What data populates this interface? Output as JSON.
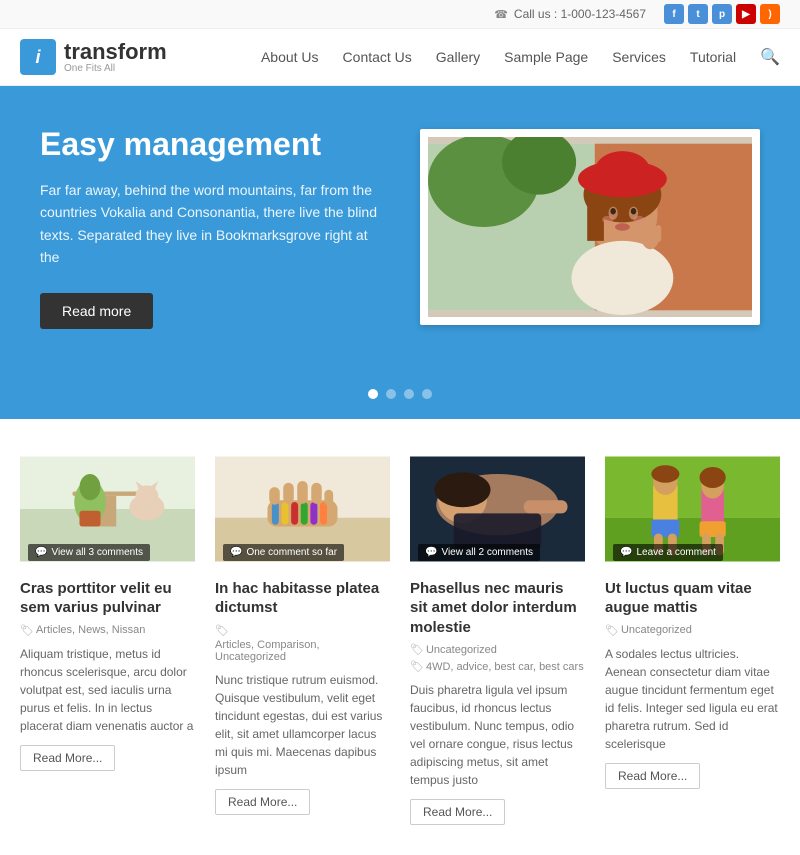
{
  "topbar": {
    "phone": "Call us : 1-000-123-4567",
    "socials": [
      {
        "name": "facebook",
        "label": "f"
      },
      {
        "name": "twitter",
        "label": "t"
      },
      {
        "name": "pinterest",
        "label": "p"
      },
      {
        "name": "youtube",
        "label": "y"
      },
      {
        "name": "rss",
        "label": "r"
      }
    ]
  },
  "header": {
    "logo_letter": "i",
    "logo_title": "transform",
    "logo_subtitle": "One Fits All",
    "nav_items": [
      {
        "label": "About Us"
      },
      {
        "label": "Contact Us"
      },
      {
        "label": "Gallery"
      },
      {
        "label": "Sample Page"
      },
      {
        "label": "Services"
      },
      {
        "label": "Tutorial"
      }
    ]
  },
  "hero": {
    "title": "Easy management",
    "text": "Far far away, behind the word mountains, far from the countries Vokalia and Consonantia, there live the blind texts. Separated they live in Bookmarksgrove right at the",
    "btn_label": "Read more",
    "dots": [
      true,
      false,
      false,
      false
    ]
  },
  "cards": [
    {
      "id": 1,
      "comment_badge": "View all 3 comments",
      "title": "Cras porttitor velit eu sem varius pulvinar",
      "tags": "Articles, News, Nissan",
      "body": "Aliquam tristique, metus id rhoncus scelerisque, arcu dolor volutpat est, sed iaculis urna purus et felis. In in lectus placerat diam venenatis auctor a",
      "readmore": "Read More..."
    },
    {
      "id": 2,
      "comment_badge": "One comment so far",
      "title": "In hac habitasse platea dictumst",
      "tags": "Articles, Comparison, Uncategorized",
      "body": "Nunc tristique rutrum euismod. Quisque vestibulum, velit eget tincidunt egestas, dui est varius elit, sit amet ullamcorper lacus mi quis mi. Maecenas dapibus ipsum",
      "readmore": "Read More..."
    },
    {
      "id": 3,
      "comment_badge": "View all 2 comments",
      "title": "Phasellus nec mauris sit amet dolor interdum molestie",
      "tags": "Uncategorized",
      "tags2": "4WD, advice, best car, best cars",
      "body": "Duis pharetra ligula vel ipsum faucibus, id rhoncus lectus vestibulum. Nunc tempus, odio vel ornare congue, risus lectus adipiscing metus, sit amet tempus justo",
      "readmore": "Read More..."
    },
    {
      "id": 4,
      "comment_badge": "Leave a comment",
      "title": "Ut luctus quam vitae augue mattis",
      "tags": "Uncategorized",
      "body": "A sodales lectus ultricies. Aenean consectetur diam vitae augue tincidunt fermentum eget id felis. Integer sed ligula eu erat pharetra rutrum. Sed id scelerisque",
      "readmore": "Read More..."
    }
  ],
  "colors": {
    "primary": "#3a9ad9",
    "dark": "#333",
    "light_gray": "#f5f5f5"
  }
}
